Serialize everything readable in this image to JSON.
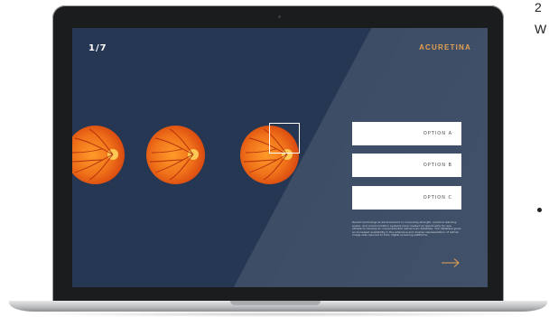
{
  "background": {
    "text_top": "2",
    "text_second": "W"
  },
  "app": {
    "brand": "ACURETINA",
    "progress": "1/7",
    "progress_current": 1,
    "progress_total": 7,
    "accent_color": "#e2953b",
    "screen_color": "#253753"
  },
  "question": {
    "images": [
      {
        "icon": "retina-fundus-image"
      },
      {
        "icon": "retina-fundus-image"
      },
      {
        "icon": "retina-fundus-image"
      }
    ],
    "selection_highlight_on_image": 3
  },
  "options": [
    {
      "label": "OPTION A"
    },
    {
      "label": "OPTION B"
    },
    {
      "label": "OPTION C"
    }
  ],
  "description": "Recent technological advancement in computing strength, machine learning, power, and communication systems have created an opportunity for eye-athlete to develop an unprecedented retinal scan database. The database gives an increased availability in the extensive and diverse representation of retinal image sets required to train digital screening platforms.",
  "navigation": {
    "next_icon": "arrow-right-icon"
  }
}
